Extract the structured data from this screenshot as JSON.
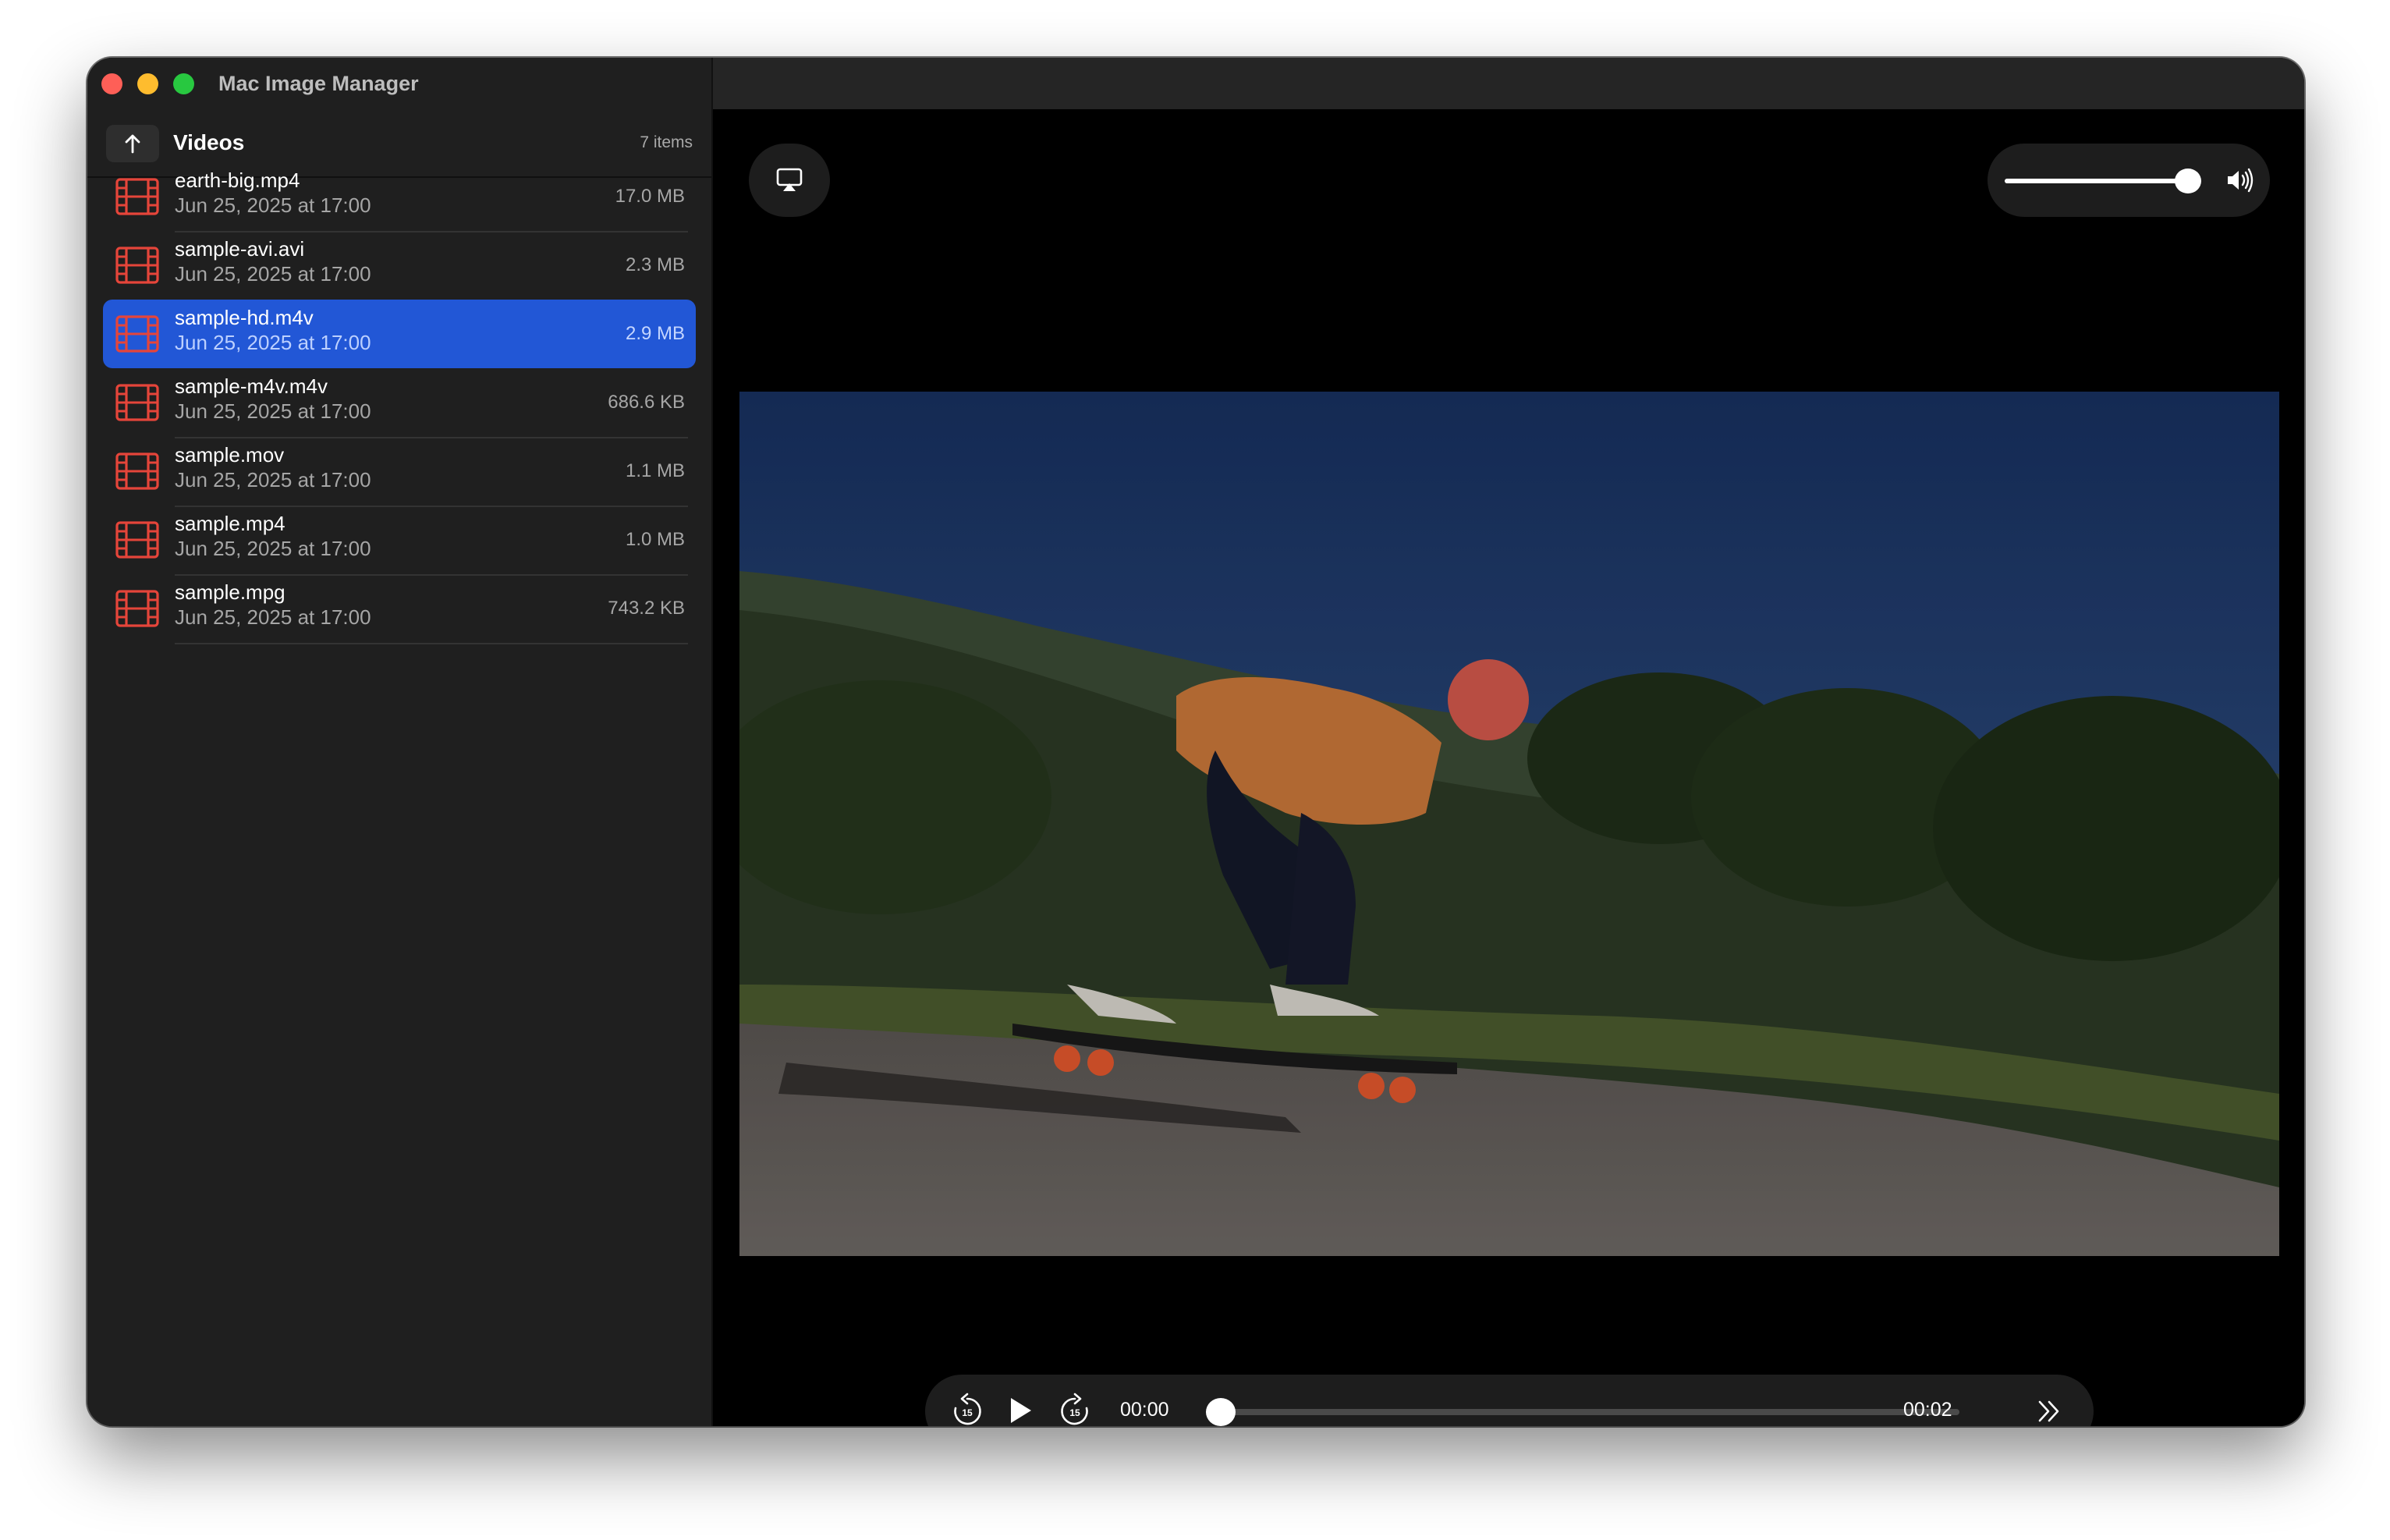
{
  "window": {
    "title": "Mac Image Manager"
  },
  "sidebar": {
    "folder_title": "Videos",
    "item_count": "7 items",
    "selected_index": 2,
    "files": [
      {
        "name": "earth-big.mp4",
        "date": "Jun 25, 2025 at 17:00",
        "size": "17.0 MB"
      },
      {
        "name": "sample-avi.avi",
        "date": "Jun 25, 2025 at 17:00",
        "size": "2.3 MB"
      },
      {
        "name": "sample-hd.m4v",
        "date": "Jun 25, 2025 at 17:00",
        "size": "2.9 MB"
      },
      {
        "name": "sample-m4v.m4v",
        "date": "Jun 25, 2025 at 17:00",
        "size": "686.6 KB"
      },
      {
        "name": "sample.mov",
        "date": "Jun 25, 2025 at 17:00",
        "size": "1.1 MB"
      },
      {
        "name": "sample.mp4",
        "date": "Jun 25, 2025 at 17:00",
        "size": "1.0 MB"
      },
      {
        "name": "sample.mpg",
        "date": "Jun 25, 2025 at 17:00",
        "size": "743.2 KB"
      }
    ]
  },
  "player": {
    "current_time": "00:00",
    "duration": "00:02",
    "progress": 0.0,
    "volume": 1.0,
    "skip_back_seconds": "15",
    "skip_forward_seconds": "15"
  },
  "colors": {
    "selection": "#2257d6",
    "file_icon": "#e5453a",
    "sidebar_bg": "#1f1f1f",
    "player_bg": "#000000"
  },
  "icons": {
    "navigate_up": "arrow-up-icon",
    "file": "film-icon",
    "airplay": "airplay-icon",
    "volume": "speaker-wave-icon",
    "skip_back": "skip-back-15-icon",
    "play": "play-icon",
    "skip_forward": "skip-forward-15-icon",
    "more": "chevron-double-right-icon"
  }
}
